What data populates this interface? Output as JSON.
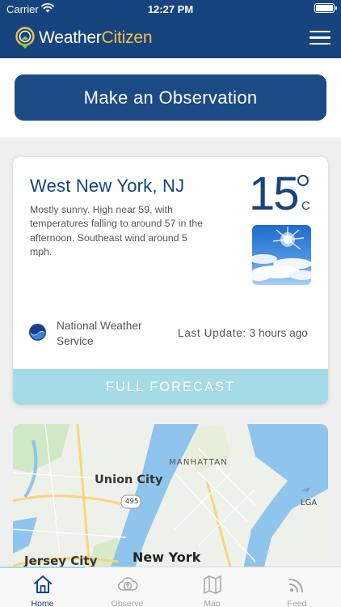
{
  "status_bar": {
    "carrier": "Carrier",
    "time": "12:27 PM"
  },
  "header": {
    "logo_part1": "Weather",
    "logo_part2": "Citizen",
    "menu_icon": "hamburger-menu-icon"
  },
  "observe": {
    "label": "Make an Observation"
  },
  "forecast_card": {
    "location": "West New York, NJ",
    "description": "Mostly sunny. High near 59, with temperatures falling to around 57 in the afternoon. Southeast wind around 5 mph.",
    "temperature": "15",
    "unit": "C",
    "condition_icon": "sunny-sky-icon",
    "source": "National Weather Service",
    "source_icon": "noaa-logo-icon",
    "last_update_label": "Last Update:",
    "last_update_value": " 3 hours ago",
    "full_forecast_label": "FULL FORECAST"
  },
  "map": {
    "labels": {
      "manhattan": "MANHATTAN",
      "union_city": "Union City",
      "route": "495",
      "lga": "LGA",
      "new_york": "New York",
      "jersey_city": "Jersey City"
    }
  },
  "tabbar": {
    "tabs": [
      {
        "label": "Home",
        "icon": "home-icon",
        "active": true
      },
      {
        "label": "Observe",
        "icon": "cloud-upload-icon",
        "active": false
      },
      {
        "label": "Map",
        "icon": "map-icon",
        "active": false
      },
      {
        "label": "Feed",
        "icon": "feed-icon",
        "active": false
      }
    ]
  },
  "colors": {
    "brand_navy": "#17447e",
    "brand_yellow": "#f5c242",
    "forecast_button": "#a4dbe6",
    "water": "#8fc4ec"
  }
}
